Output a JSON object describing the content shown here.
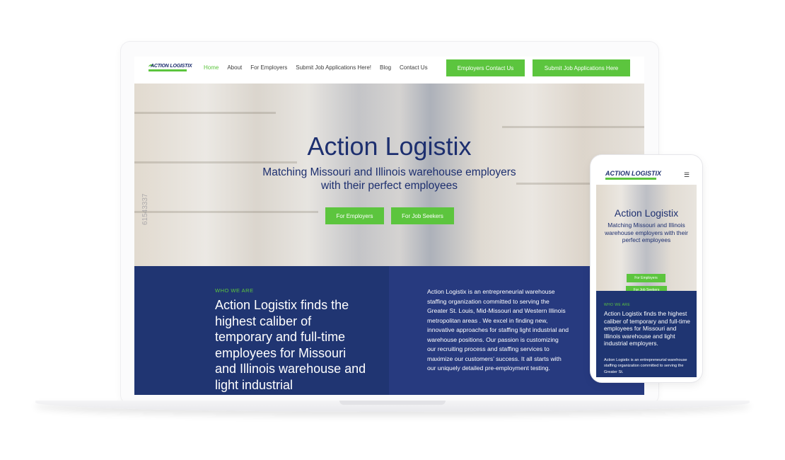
{
  "desktop": {
    "logo": {
      "text": "ACTION LOGISTIX"
    },
    "nav": [
      "Home",
      "About",
      "For Employers",
      "Submit Job Applications Here!",
      "Blog",
      "Contact Us"
    ],
    "header_buttons": {
      "employers": "Employers Contact Us",
      "submit": "Submit Job Applications Here"
    },
    "hero": {
      "title": "Action Logistix",
      "subtitle": "Matching Missouri and Illinois warehouse employers with their perfect employees",
      "button_employers": "For Employers",
      "button_seekers": "For Job Seekers",
      "watermark": "61543337"
    },
    "who": {
      "eyebrow": "WHO WE ARE",
      "heading": "Action Logistix finds the highest caliber of temporary and full-time employees for Missouri and Illinois warehouse and light industrial",
      "body": "Action Logistix is an entrepreneurial warehouse staffing organization committed to serving the Greater St. Louis, Mid-Missouri and Western Illinois metropolitan areas . We excel in finding new, innovative approaches for staffing light industrial and warehouse positions. Our passion is customizing our recruiting process and staffing services to maximize our customers’ success. It all starts with our uniquely detailed pre-employment testing."
    }
  },
  "mobile": {
    "logo": {
      "text": "ACTION LOGISTIX"
    },
    "menu_icon": "hamburger-icon",
    "hero": {
      "title": "Action Logistix",
      "subtitle": "Matching Missouri and Illinois warehouse employers with their perfect employees",
      "button_employers": "For Employers",
      "button_seekers": "For Job Seekers"
    },
    "who": {
      "eyebrow": "WHO WE ARE",
      "heading": "Action Logistix finds the highest caliber of temporary and full-time employees for Missouri and Illinois warehouse and light industrial employers.",
      "body": "Action Logistix is an entrepreneurial warehouse staffing organization committed to serving the Greater St."
    }
  },
  "colors": {
    "brand_green": "#5cc53e",
    "brand_navy": "#1d2f6f",
    "section_blue": "#273a7f"
  }
}
